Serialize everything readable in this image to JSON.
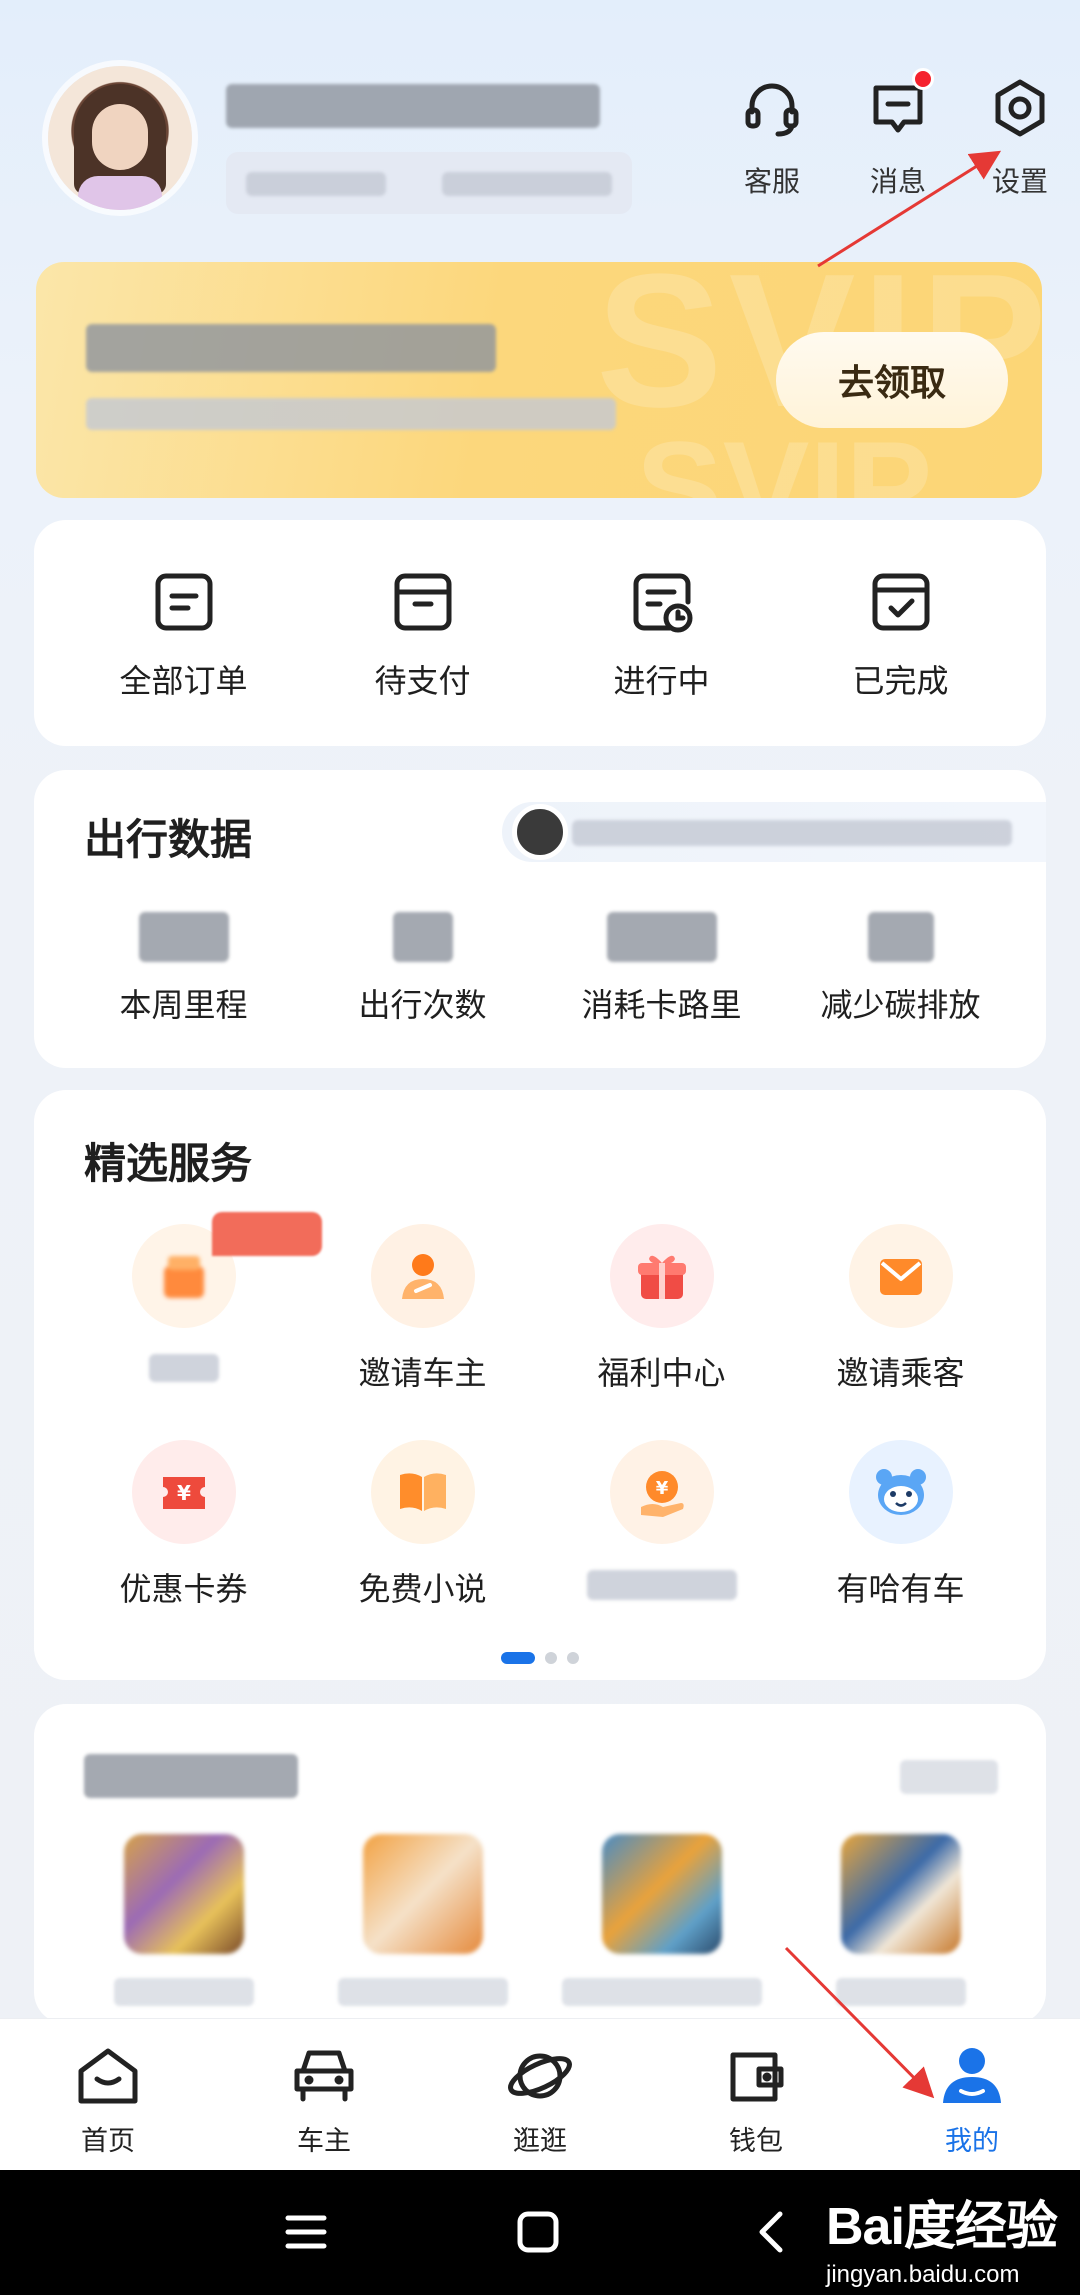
{
  "header": {
    "actions": [
      {
        "label": "客服",
        "icon": "headset-icon"
      },
      {
        "label": "消息",
        "icon": "message-icon",
        "has_badge": true
      },
      {
        "label": "设置",
        "icon": "settings-icon"
      }
    ]
  },
  "vip_banner": {
    "claim_label": "去领取",
    "watermark_top": "SVIP",
    "watermark_bottom": "SVIP"
  },
  "orders": {
    "items": [
      {
        "label": "全部订单",
        "icon": "all-orders-icon"
      },
      {
        "label": "待支付",
        "icon": "pending-payment-icon"
      },
      {
        "label": "进行中",
        "icon": "in-progress-icon"
      },
      {
        "label": "已完成",
        "icon": "completed-icon"
      }
    ]
  },
  "travel_data": {
    "title": "出行数据",
    "items": [
      {
        "label": "本周里程"
      },
      {
        "label": "出行次数"
      },
      {
        "label": "消耗卡路里"
      },
      {
        "label": "减少碳排放"
      }
    ]
  },
  "services": {
    "title": "精选服务",
    "row1": [
      {
        "label": "",
        "icon": "gift-box-icon"
      },
      {
        "label": "邀请车主",
        "icon": "person-icon"
      },
      {
        "label": "福利中心",
        "icon": "gift-icon"
      },
      {
        "label": "邀请乘客",
        "icon": "envelope-icon"
      }
    ],
    "row2": [
      {
        "label": "优惠卡券",
        "icon": "coupon-icon"
      },
      {
        "label": "免费小说",
        "icon": "book-icon"
      },
      {
        "label": "",
        "icon": "coin-hand-icon"
      },
      {
        "label": "有哈有车",
        "icon": "mascot-icon"
      }
    ],
    "page_count": 3,
    "current_page": 1
  },
  "bottom_nav": {
    "items": [
      {
        "label": "首页",
        "icon": "home-icon",
        "active": false
      },
      {
        "label": "车主",
        "icon": "car-icon",
        "active": false
      },
      {
        "label": "逛逛",
        "icon": "planet-icon",
        "active": false
      },
      {
        "label": "钱包",
        "icon": "wallet-icon",
        "active": false
      },
      {
        "label": "我的",
        "icon": "profile-icon",
        "active": true
      }
    ]
  },
  "watermark": {
    "brand": "Bai度经验",
    "url": "jingyan.baidu.com"
  },
  "colors": {
    "accent": "#1a73e8",
    "badge": "#f5222d",
    "vip_gold": "#fcd77c",
    "arrow": "#e53935"
  }
}
